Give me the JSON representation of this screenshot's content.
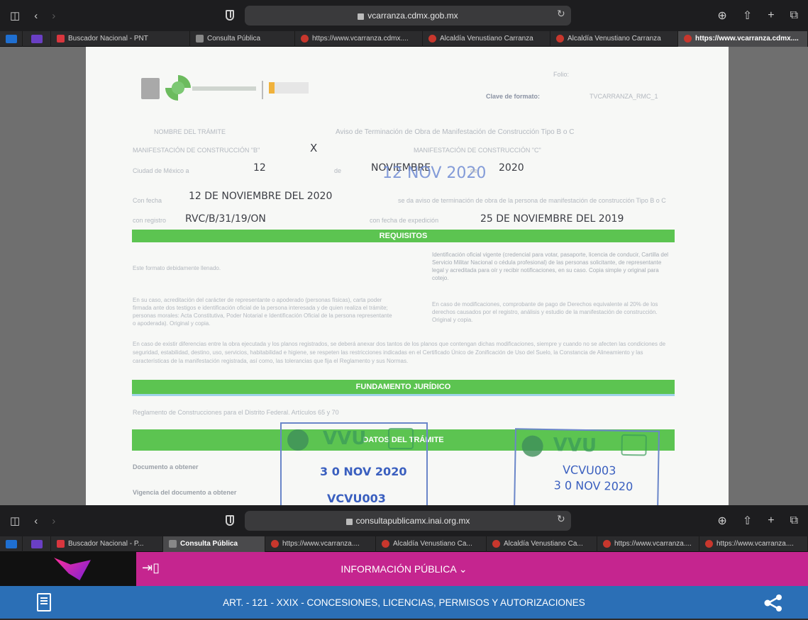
{
  "window_top": {
    "url": "vcarranza.cdmx.gob.mx",
    "tabs": [
      {
        "label": "Buscador Nacional - PNT",
        "icon": "pnt-icon"
      },
      {
        "label": "Consulta Pública",
        "icon": "page-icon"
      },
      {
        "label": "https://www.vcarranza.cdmx....",
        "icon": "red-favicon"
      },
      {
        "label": "Alcaldía Venustiano Carranza",
        "icon": "red-favicon"
      },
      {
        "label": "Alcaldía Venustiano Carranza",
        "icon": "red-favicon"
      },
      {
        "label": "https://www.vcarranza.cdmx....",
        "icon": "red-favicon",
        "active": true
      }
    ]
  },
  "document": {
    "header_right": "Folio:",
    "clave_label": "Clave de formato:",
    "clave_value": "TVCARRANZA_RMC_1",
    "nombre_tramite_label": "NOMBRE DEL TRÁMITE",
    "nombre_tramite": "Aviso de Terminación de Obra de Manifestación de Construcción Tipo B o C",
    "manif_b_label": "MANIFESTACIÓN DE CONSTRUCCIÓN \"B\"",
    "manif_b_mark": "X",
    "manif_c_label": "MANIFESTACIÓN DE CONSTRUCCIÓN \"C\"",
    "ciudad_label": "Ciudad de México a",
    "dia": "12",
    "de1": "de",
    "mes": "NOVIEMBRE",
    "stamp_date_top": "12 NOV 2020",
    "de2": "de",
    "anio": "2020",
    "fecha_label": "Con fecha",
    "fecha_value": "12 DE NOVIEMBRE DEL 2020",
    "fecha_text": "se da aviso de terminación de obra de la persona de manifestación de construcción Tipo B o C",
    "registro_label": "con registro",
    "registro_value": "RVC/B/31/19/ON",
    "fecha_reg_label": "con fecha de expedición",
    "fecha_reg_value": "25 DE NOVIEMBRE  DEL 2019",
    "requisitos_title": "REQUISITOS",
    "req_left_1": "Este formato debidamente llenado.",
    "req_left_2": "En su caso, acreditación del carácter de representante o apoderado (personas físicas), carta poder firmada ante dos testigos e identificación oficial de la persona interesada y de quien realiza el trámite; personas morales: Acta Constitutiva, Poder Notarial e Identificación Oficial de la persona representante o apoderada). Original y copia.",
    "req_right_1": "Identificación oficial vigente (credencial para votar, pasaporte, licencia de conducir, Cartilla del Servicio Militar Nacional o cédula profesional) de las personas solicitante, de representante legal y acreditada para oír y recibir notificaciones, en su caso. Copia simple y original para cotejo.",
    "req_right_2": "En caso de modificaciones, comprobante de pago de Derechos equivalente al 20% de los derechos causados por el registro, análisis y estudio de la manifestación de construcción. Original y copia.",
    "req_bottom": "En caso de existir diferencias entre la obra ejecutada y los planos registrados, se deberá anexar dos tantos de los planos que contengan dichas modificaciones, siempre y cuando no se afecten las condiciones de seguridad, estabilidad, destino, uso, servicios, habitabilidad e higiene, se respeten las restricciones indicadas en el Certificado Único de Zonificación de Uso del Suelo, la Constancia de Alineamiento y las características de la manifestación registrada, así como, las tolerancias que fija el Reglamento y sus Normas.",
    "fundamento_title": "FUNDAMENTO JURÍDICO",
    "fundamento_text": "Reglamento de Construcciones para el Distrito Federal. Artículos 65 y 70",
    "datos_title": "DATOS DEL TRÁMITE",
    "doc_obtener": "Documento a obtener",
    "vigencia": "Vigencia del documento a obtener",
    "stamp1_date": "3 0 NOV 2020",
    "stamp1_code": "VCVU003",
    "stamp2_code": "VCVU003",
    "stamp2_date": "3 0 NOV 2020",
    "stamp_logo": "VVU"
  },
  "window_bottom": {
    "url": "consultapublicamx.inai.org.mx",
    "tabs": [
      {
        "label": "Buscador Nacional - P...",
        "icon": "pnt-icon"
      },
      {
        "label": "Consulta Pública",
        "icon": "page-icon",
        "active": true
      },
      {
        "label": "https://www.vcarranza....",
        "icon": "red-favicon"
      },
      {
        "label": "Alcaldía Venustiano Ca...",
        "icon": "red-favicon"
      },
      {
        "label": "Alcaldía Venustiano Ca...",
        "icon": "red-favicon"
      },
      {
        "label": "https://www.vcarranza....",
        "icon": "red-favicon"
      },
      {
        "label": "https://www.vcarranza....",
        "icon": "red-favicon"
      }
    ]
  },
  "portal": {
    "menu_label": "INFORMACIÓN PÚBLICA ⌄",
    "article": "ART. - 121 - XXIX - CONCESIONES, LICENCIAS, PERMISOS Y AUTORIZACIONES",
    "colors": {
      "pink": "#c5258f",
      "blue": "#2b6fb6",
      "green": "#5cc451"
    }
  }
}
